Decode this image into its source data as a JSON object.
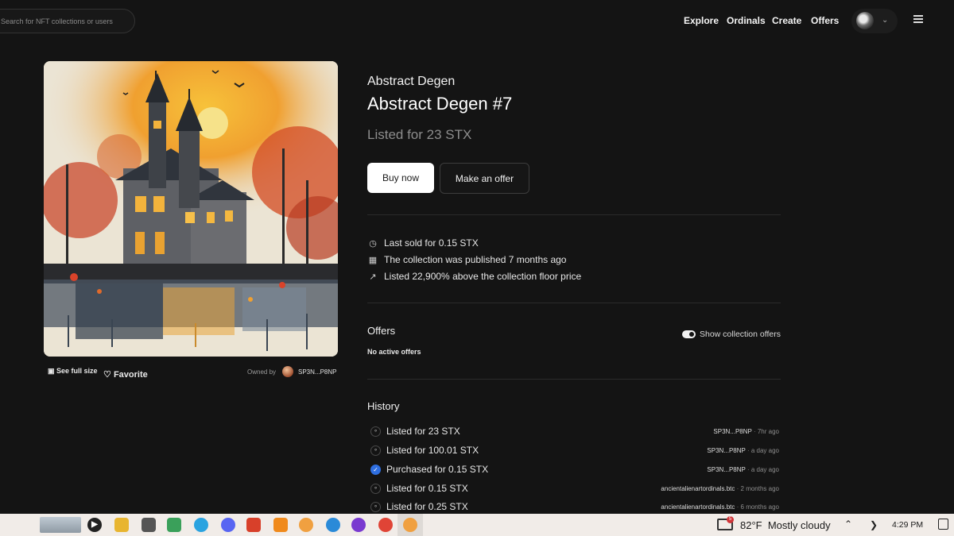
{
  "search": {
    "placeholder": "Search for NFT collections or users"
  },
  "nav": {
    "items": [
      "Explore",
      "Ordinals",
      "Create",
      "Offers"
    ]
  },
  "artwork": {
    "see_full_label": "See full size",
    "favorite_label": "Favorite",
    "owned_by_label": "Owned by",
    "owner": "SP3N...P8NP"
  },
  "item": {
    "collection": "Abstract Degen",
    "title": "Abstract Degen #7",
    "price_text": "Listed for 23 STX"
  },
  "actions": {
    "buy_label": "Buy now",
    "offer_label": "Make an offer"
  },
  "facts": [
    {
      "icon": "clock-icon",
      "text": "Last sold for 0.15 STX"
    },
    {
      "icon": "calendar-icon",
      "text": "The collection was published 7 months ago"
    },
    {
      "icon": "trending-up-icon",
      "text": "Listed 22,900% above the collection floor price"
    }
  ],
  "offers": {
    "heading": "Offers",
    "empty_text": "No active offers",
    "toggle_label": "Show collection offers",
    "toggle_on": true
  },
  "history": {
    "heading": "History",
    "rows": [
      {
        "icon": "tag-icon",
        "text": "Listed for 23 STX",
        "user": "SP3N...P8NP",
        "ago": "7hr ago"
      },
      {
        "icon": "tag-icon",
        "text": "Listed for 100.01 STX",
        "user": "SP3N...P8NP",
        "ago": "a day ago"
      },
      {
        "icon": "check-circle-icon",
        "text": "Purchased for 0.15 STX",
        "user": "SP3N...P8NP",
        "ago": "a day ago"
      },
      {
        "icon": "tag-icon",
        "text": "Listed for 0.15 STX",
        "user": "ancientalienartordinals.btc",
        "ago": "2 months ago"
      },
      {
        "icon": "tag-icon",
        "text": "Listed for 0.25 STX",
        "user": "ancientalienartordinals.btc",
        "ago": "6 months ago"
      }
    ]
  },
  "taskbar": {
    "temperature": "82°F",
    "weather": "Mostly cloudy",
    "time": "4:29 PM",
    "badge": "5"
  },
  "colors": {
    "background": "#141414",
    "accent_blue": "#2f6fe0",
    "muted_text": "#8d8d8d"
  }
}
